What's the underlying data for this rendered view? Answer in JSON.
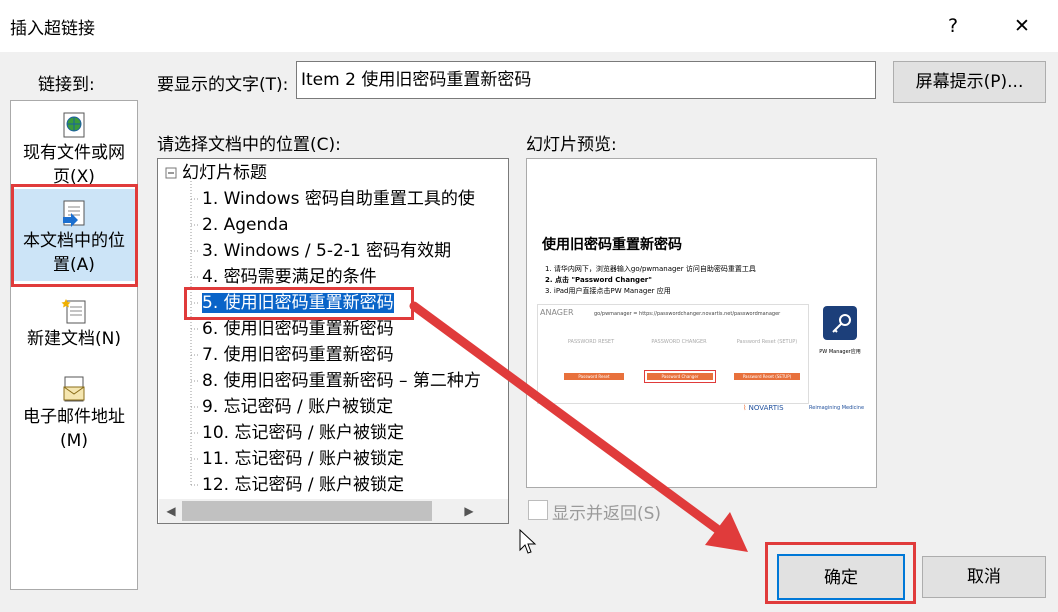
{
  "window": {
    "title": "插入超链接",
    "help_label": "?",
    "close_label": "✕"
  },
  "link_to": {
    "label": "链接到:",
    "items": [
      {
        "line1": "现有文件或网",
        "line2": "页(X)",
        "icon": "globe-document-icon"
      },
      {
        "line1": "本文档中的位",
        "line2": "置(A)",
        "icon": "document-place-icon"
      },
      {
        "line1": "新建文档(N)",
        "line2": "",
        "icon": "new-document-icon"
      },
      {
        "line1": "电子邮件地址",
        "line2": "(M)",
        "icon": "email-icon"
      }
    ]
  },
  "display_text": {
    "label": "要显示的文字(T):",
    "value": "Item 2  使用旧密码重置新密码"
  },
  "screentip_button": "屏幕提示(P)...",
  "tree": {
    "label": "请选择文档中的位置(C):",
    "root": "幻灯片标题",
    "items": [
      "1. Windows 密码自助重置工具的使",
      "2. Agenda",
      "3. Windows / 5-2-1 密码有效期",
      "4. 密码需要满足的条件",
      "5. 使用旧密码重置新密码",
      "6. 使用旧密码重置新密码",
      "7. 使用旧密码重置新密码",
      "8. 使用旧密码重置新密码 – 第二种方",
      "9. 忘记密码 / 账户被锁定",
      "10. 忘记密码 / 账户被锁定",
      "11. 忘记密码 / 账户被锁定",
      "12. 忘记密码 / 账户被锁定"
    ],
    "selected_index": 4
  },
  "preview": {
    "label": "幻灯片预览:",
    "slide": {
      "title": "使用旧密码重置新密码",
      "lines": [
        "1.  请华内网下，浏览器输入go/pwmanager 访问自助密码重置工具",
        "2.  点击 \"Password Changer\"",
        "3.  iPad用户直接点击PW Manager 应用"
      ],
      "url_bar": "go/pwmanager = https://passwordchanger.novartis.net/passwordmanager",
      "manager_text": "ANAGER",
      "cols": [
        "PASSWORD RESET",
        "PASSWORD CHANGER",
        "Password Reset (SETUP)"
      ],
      "col_buttons": [
        "Password Reset",
        "Password Changer",
        "Password Reset (SETUP)"
      ],
      "app_label": "PW Manager应用",
      "brand": "NOVARTIS",
      "tagline": "Reimagining Medicine"
    }
  },
  "show_and_return": "显示并返回(S)",
  "ok_button": "确定",
  "cancel_button": "取消",
  "colors": {
    "selection": "#0a64c8",
    "highlight_red": "#e03b3b",
    "accent_orange": "#e8713c"
  }
}
